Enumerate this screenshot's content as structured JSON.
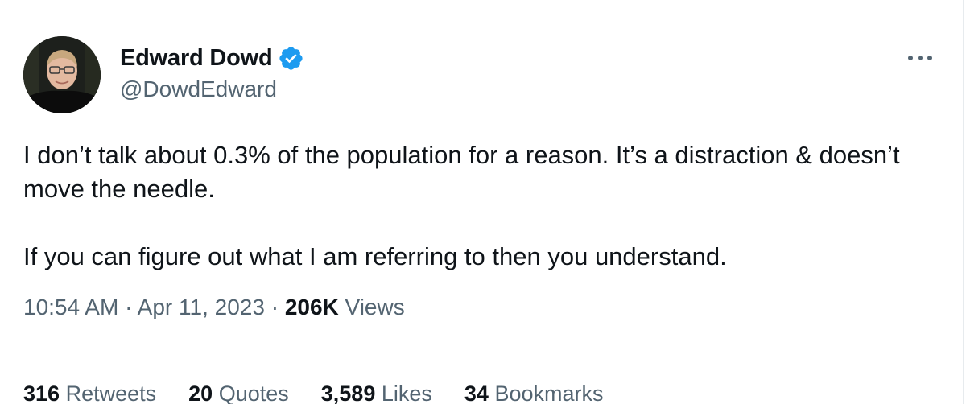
{
  "author": {
    "name": "Edward Dowd",
    "handle": "@DowdEdward",
    "verified": true,
    "avatar_icon": "person-photo-avatar"
  },
  "tweet": {
    "paragraphs": [
      "I don’t talk about 0.3% of the population for a reason. It’s a distraction & doesn’t move the needle.",
      "If you can figure out what I am referring to then you understand."
    ],
    "time": "10:54 AM",
    "separator": "·",
    "date": "Apr 11, 2023",
    "views_count": "206K",
    "views_label": "Views"
  },
  "stats": [
    {
      "count": "316",
      "label": "Retweets"
    },
    {
      "count": "20",
      "label": "Quotes"
    },
    {
      "count": "3,589",
      "label": "Likes"
    },
    {
      "count": "34",
      "label": "Bookmarks"
    }
  ],
  "icons": {
    "verified": "verified-badge-icon",
    "more": "more-icon"
  },
  "colors": {
    "text_primary": "#0f1419",
    "text_secondary": "#536471",
    "verified_blue": "#1d9bf0",
    "divider": "#e1e6ea"
  }
}
